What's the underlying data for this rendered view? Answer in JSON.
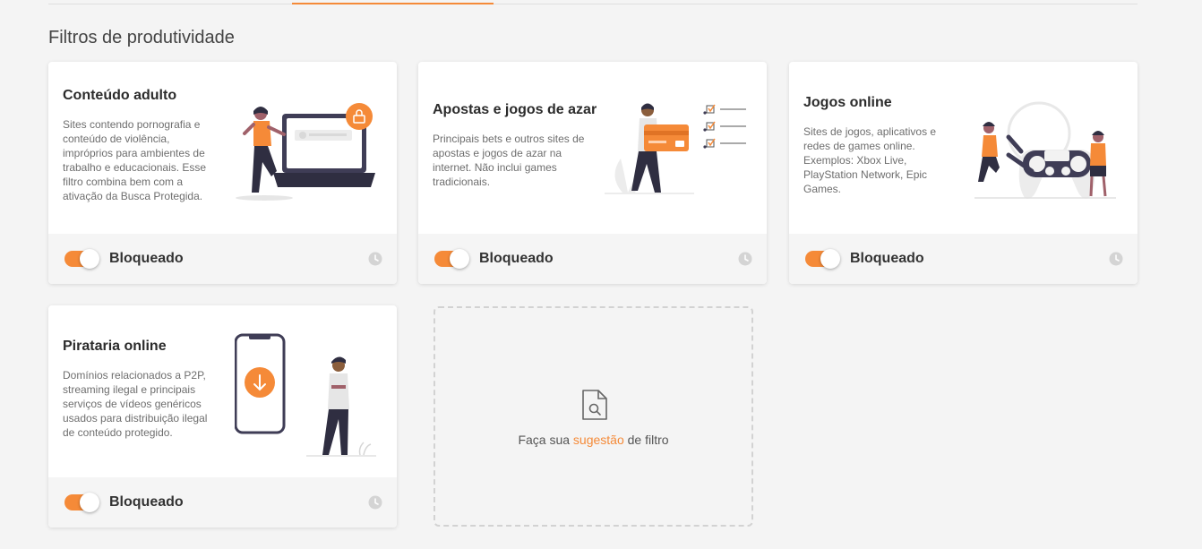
{
  "section": {
    "title": "Filtros de produtividade"
  },
  "colors": {
    "accent": "#f58a38",
    "text": "#333333",
    "muted": "#6e6e6e",
    "background": "#f4f4f4"
  },
  "cards": [
    {
      "title": "Conteúdo adulto",
      "description": "Sites contendo pornografia e conteúdo de violência, impróprios para ambientes de trabalho e educacionais. Esse filtro combina bem com a ativação da Busca Protegida.",
      "status": "Bloqueado",
      "toggle_on": true,
      "icon": "woman-laptop-lock-illustration"
    },
    {
      "title": "Apostas e jogos de azar",
      "description": "Principais bets e outros sites de apostas e jogos de azar na internet. Não inclui games tradicionais.",
      "status": "Bloqueado",
      "toggle_on": true,
      "icon": "man-credit-card-checklist-illustration"
    },
    {
      "title": "Jogos online",
      "description": "Sites de jogos, aplicativos e redes de games online. Exemplos: Xbox Live, PlayStation Network, Epic Games.",
      "status": "Bloqueado",
      "toggle_on": true,
      "icon": "people-gamepad-illustration"
    },
    {
      "title": "Pirataria online",
      "description": "Domínios relacionados a P2P, streaming ilegal e principais serviços de vídeos genéricos usados para distribuição ilegal de conteúdo protegido.",
      "status": "Bloqueado",
      "toggle_on": true,
      "icon": "phone-download-man-illustration"
    }
  ],
  "suggestion": {
    "prefix": "Faça sua",
    "link": "sugestão",
    "suffix": "de filtro",
    "icon": "document-search-icon"
  }
}
